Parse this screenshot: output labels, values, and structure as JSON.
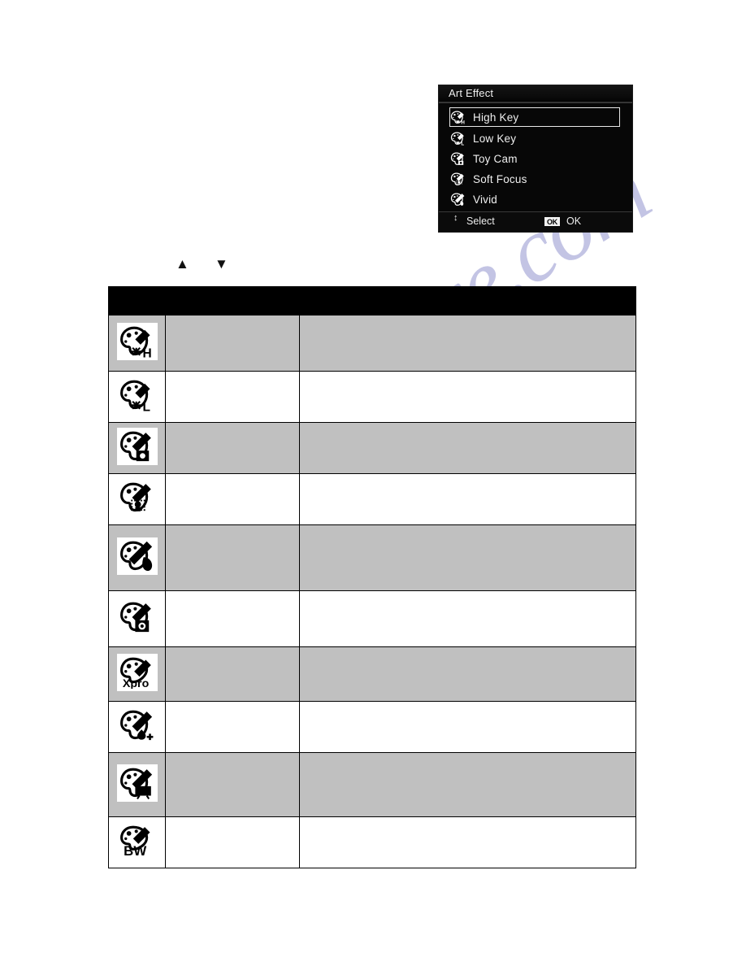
{
  "page": {
    "background": "#ffffff",
    "watermark": "manualshive.com",
    "watermark_color": "#b9bae0"
  },
  "osd": {
    "title": "Art Effect",
    "selected_index": 0,
    "items": [
      {
        "label": "High Key",
        "icon": "palette-high-key-icon"
      },
      {
        "label": "Low Key",
        "icon": "palette-low-key-icon"
      },
      {
        "label": "Toy Cam",
        "icon": "palette-toy-cam-icon"
      },
      {
        "label": "Soft Focus",
        "icon": "palette-soft-focus-icon"
      },
      {
        "label": "Vivid",
        "icon": "palette-vivid-icon"
      }
    ],
    "footer": {
      "updown_glyph": "↕",
      "select_label": "Select",
      "ok_badge": "OK",
      "ok_label": "OK"
    }
  },
  "nav_arrows": {
    "up": "▲",
    "down": "▼"
  },
  "table": {
    "header": {
      "columns": [
        "",
        "",
        ""
      ]
    },
    "rows": [
      {
        "icon": "palette-high-key-icon",
        "name": "",
        "description": "",
        "shade": "gray"
      },
      {
        "icon": "palette-low-key-icon",
        "name": "",
        "description": "",
        "shade": "white"
      },
      {
        "icon": "palette-toy-cam-icon",
        "name": "",
        "description": "",
        "shade": "gray"
      },
      {
        "icon": "palette-soft-focus-icon",
        "name": "",
        "description": "",
        "shade": "white"
      },
      {
        "icon": "palette-vivid-icon",
        "name": "",
        "description": "",
        "shade": "gray"
      },
      {
        "icon": "palette-lomo-icon",
        "name": "",
        "description": "",
        "shade": "white"
      },
      {
        "icon": "palette-xpro-icon",
        "name": "",
        "description": "",
        "shade": "gray"
      },
      {
        "icon": "palette-water-color-icon",
        "name": "",
        "description": "",
        "shade": "white"
      },
      {
        "icon": "palette-tv-icon",
        "name": "",
        "description": "",
        "shade": "gray"
      },
      {
        "icon": "palette-bw-icon",
        "name": "",
        "description": "",
        "shade": "white"
      }
    ]
  }
}
